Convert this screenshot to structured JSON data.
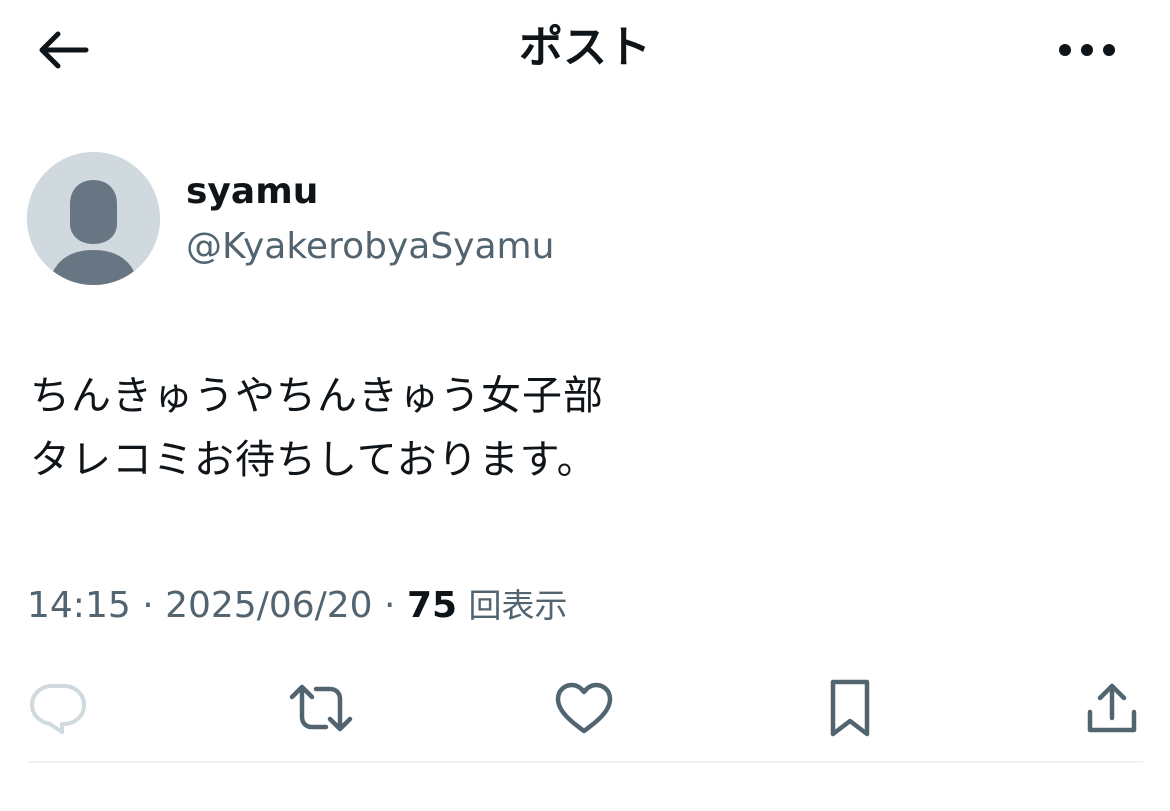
{
  "header": {
    "title": "ポスト",
    "back_icon": "arrow-left-icon",
    "more_icon": "more-horizontal-icon"
  },
  "author": {
    "name": "syamu",
    "handle": "@KyakerobyaSyamu",
    "avatar_icon": "default-avatar-icon"
  },
  "post": {
    "lines": [
      "ちんきゅうやちんきゅう女子部",
      "タレコミお待ちしております。"
    ]
  },
  "meta": {
    "time": "14:15",
    "separator": " · ",
    "date": "2025/06/20",
    "views_count": "75",
    "views_label": "回表示"
  },
  "actions": {
    "icons": [
      "reply-icon",
      "retweet-icon",
      "like-icon",
      "bookmark-icon",
      "share-icon"
    ]
  },
  "colors": {
    "text_primary": "#0f1419",
    "text_secondary": "#536471",
    "icon": "#536471",
    "reply_icon_disabled": "#cfd9de",
    "avatar_bg": "#cfd9de",
    "avatar_figure": "#687684",
    "divider": "#eff3f4"
  }
}
